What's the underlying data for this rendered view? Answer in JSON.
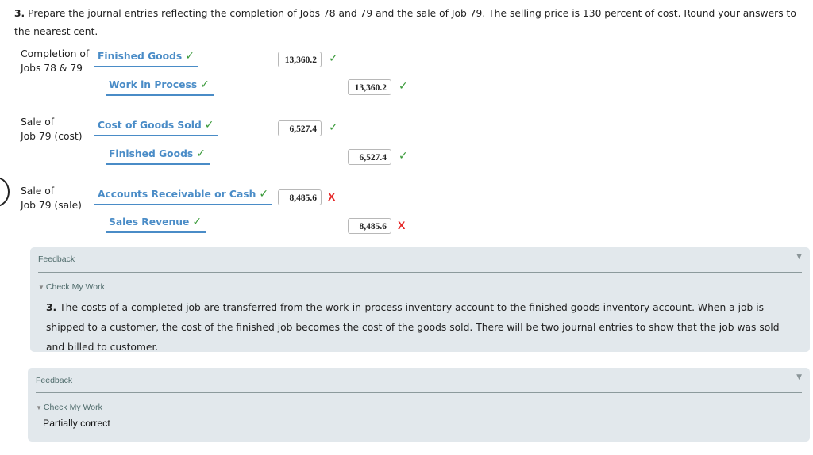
{
  "question": {
    "number": "3.",
    "text": "Prepare the journal entries reflecting the completion of Jobs 78 and 79 and the sale of Job 79. The selling price is 130 percent of cost. Round your answers to the nearest cent."
  },
  "entries": [
    {
      "label_line1": "Completion of",
      "label_line2": "Jobs 78 & 79",
      "debit": {
        "account": "Finished Goods",
        "account_mark": "✓",
        "amount": "13,360.2",
        "amount_mark": "✓",
        "amount_correct": true
      },
      "credit": {
        "account": "Work in Process",
        "account_mark": "✓",
        "amount": "13,360.2",
        "amount_mark": "✓",
        "amount_correct": true
      }
    },
    {
      "label_line1": "Sale of",
      "label_line2": "Job 79 (cost)",
      "debit": {
        "account": "Cost of Goods Sold",
        "account_mark": "✓",
        "amount": "6,527.4",
        "amount_mark": "✓",
        "amount_correct": true
      },
      "credit": {
        "account": "Finished Goods",
        "account_mark": "✓",
        "amount": "6,527.4",
        "amount_mark": "✓",
        "amount_correct": true
      }
    },
    {
      "label_line1": "Sale of",
      "label_line2": "Job 79 (sale)",
      "debit": {
        "account": "Accounts Receivable or Cash",
        "account_mark": "✓",
        "amount": "8,485.6",
        "amount_mark": "X",
        "amount_correct": false
      },
      "credit": {
        "account": "Sales Revenue",
        "account_mark": "✓",
        "amount": "8,485.6",
        "amount_mark": "X",
        "amount_correct": false
      }
    }
  ],
  "feedback_panels": [
    {
      "title": "Feedback",
      "toggle": "▼",
      "check_my_work": "Check My Work",
      "explanation_number": "3.",
      "explanation": "The costs of a completed job are transferred from the work-in-process inventory account to the finished goods inventory account. When a job is shipped to a customer, the cost of the finished job becomes the cost of the goods sold. There will be two journal entries to show that the job was sold and billed to customer."
    },
    {
      "title": "Feedback",
      "toggle": "▼",
      "check_my_work": "Check My Work",
      "status": "Partially correct"
    }
  ],
  "colors": {
    "account_link": "#4a8cc7",
    "correct": "#3a9a3a",
    "incorrect": "#e52a2a",
    "panel_bg": "#e2e8ec"
  }
}
